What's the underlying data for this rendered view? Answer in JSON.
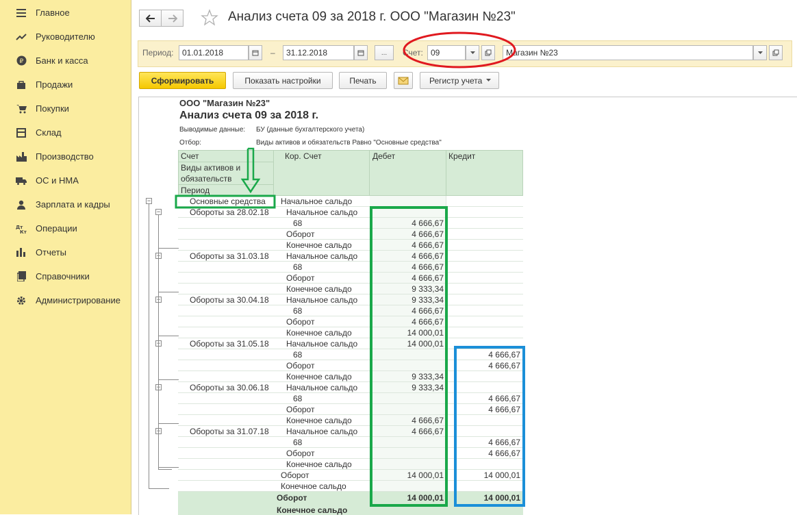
{
  "sidebar": {
    "items": [
      {
        "label": "Главное",
        "icon": "menu-icon"
      },
      {
        "label": "Руководителю",
        "icon": "trend-icon"
      },
      {
        "label": "Банк и касса",
        "icon": "ruble-icon"
      },
      {
        "label": "Продажи",
        "icon": "bag-icon"
      },
      {
        "label": "Покупки",
        "icon": "cart-icon"
      },
      {
        "label": "Склад",
        "icon": "warehouse-icon"
      },
      {
        "label": "Производство",
        "icon": "factory-icon"
      },
      {
        "label": "ОС и НМА",
        "icon": "truck-icon"
      },
      {
        "label": "Зарплата и кадры",
        "icon": "person-icon"
      },
      {
        "label": "Операции",
        "icon": "dt-kt-icon"
      },
      {
        "label": "Отчеты",
        "icon": "bar-chart-icon"
      },
      {
        "label": "Справочники",
        "icon": "book-icon"
      },
      {
        "label": "Администрирование",
        "icon": "gear-icon"
      }
    ]
  },
  "header": {
    "title": "Анализ счета 09 за 2018 г. ООО \"Магазин №23\""
  },
  "params": {
    "period_label": "Период:",
    "date_from": "01.01.2018",
    "dash": "–",
    "date_to": "31.12.2018",
    "ellipsis": "...",
    "account_label": "Счет:",
    "account": "09",
    "org": "Магазин №23"
  },
  "toolbar": {
    "generate": "Сформировать",
    "show_settings": "Показать настройки",
    "print": "Печать",
    "register": "Регистр учета"
  },
  "report": {
    "org": "ООО \"Магазин №23\"",
    "title": "Анализ счета 09 за 2018 г.",
    "output_label": "Выводимые данные:",
    "output_value": "БУ (данные бухгалтерского учета)",
    "filter_label": "Отбор:",
    "filter_value": "Виды активов и обязательств Равно \"Основные средства\"",
    "col_account": "Счет",
    "col_asset_type_1": "Виды активов и",
    "col_asset_type_2": "обязательств",
    "col_period": "Период",
    "col_corr": "Кор. Счет",
    "col_debit": "Дебет",
    "col_credit": "Кредит",
    "rows": [
      {
        "a": "Основные средства",
        "b": "Начальное сальдо",
        "d": "",
        "c": ""
      },
      {
        "a": "Обороты за 28.02.18",
        "b": "Начальное сальдо",
        "d": "",
        "c": ""
      },
      {
        "a": "",
        "b": "68",
        "d": "4 666,67",
        "c": ""
      },
      {
        "a": "",
        "b": "Оборот",
        "d": "4 666,67",
        "c": ""
      },
      {
        "a": "",
        "b": "Конечное сальдо",
        "d": "4 666,67",
        "c": ""
      },
      {
        "a": "Обороты за 31.03.18",
        "b": "Начальное сальдо",
        "d": "4 666,67",
        "c": ""
      },
      {
        "a": "",
        "b": "68",
        "d": "4 666,67",
        "c": ""
      },
      {
        "a": "",
        "b": "Оборот",
        "d": "4 666,67",
        "c": ""
      },
      {
        "a": "",
        "b": "Конечное сальдо",
        "d": "9 333,34",
        "c": ""
      },
      {
        "a": "Обороты за 30.04.18",
        "b": "Начальное сальдо",
        "d": "9 333,34",
        "c": ""
      },
      {
        "a": "",
        "b": "68",
        "d": "4 666,67",
        "c": ""
      },
      {
        "a": "",
        "b": "Оборот",
        "d": "4 666,67",
        "c": ""
      },
      {
        "a": "",
        "b": "Конечное сальдо",
        "d": "14 000,01",
        "c": ""
      },
      {
        "a": "Обороты за 31.05.18",
        "b": "Начальное сальдо",
        "d": "14 000,01",
        "c": ""
      },
      {
        "a": "",
        "b": "68",
        "d": "",
        "c": "4 666,67"
      },
      {
        "a": "",
        "b": "Оборот",
        "d": "",
        "c": "4 666,67"
      },
      {
        "a": "",
        "b": "Конечное сальдо",
        "d": "9 333,34",
        "c": ""
      },
      {
        "a": "Обороты за 30.06.18",
        "b": "Начальное сальдо",
        "d": "9 333,34",
        "c": ""
      },
      {
        "a": "",
        "b": "68",
        "d": "",
        "c": "4 666,67"
      },
      {
        "a": "",
        "b": "Оборот",
        "d": "",
        "c": "4 666,67"
      },
      {
        "a": "",
        "b": "Конечное сальдо",
        "d": "4 666,67",
        "c": ""
      },
      {
        "a": "Обороты за 31.07.18",
        "b": "Начальное сальдо",
        "d": "4 666,67",
        "c": ""
      },
      {
        "a": "",
        "b": "68",
        "d": "",
        "c": "4 666,67"
      },
      {
        "a": "",
        "b": "Оборот",
        "d": "",
        "c": "4 666,67"
      },
      {
        "a": "",
        "b": "Конечное сальдо",
        "d": "",
        "c": ""
      },
      {
        "a": "",
        "b": "Оборот",
        "d": "14 000,01",
        "c": "14 000,01"
      },
      {
        "a": "",
        "b": "Конечное сальдо",
        "d": "",
        "c": ""
      }
    ],
    "total_turnover_label": "Оборот",
    "total_debit": "14 000,01",
    "total_credit": "14 000,01",
    "total_end_label": "Конечное сальдо"
  },
  "annotations": {
    "red_color": "#e0191f",
    "green_color": "#1aa84a",
    "blue_color": "#1b8fd8"
  }
}
